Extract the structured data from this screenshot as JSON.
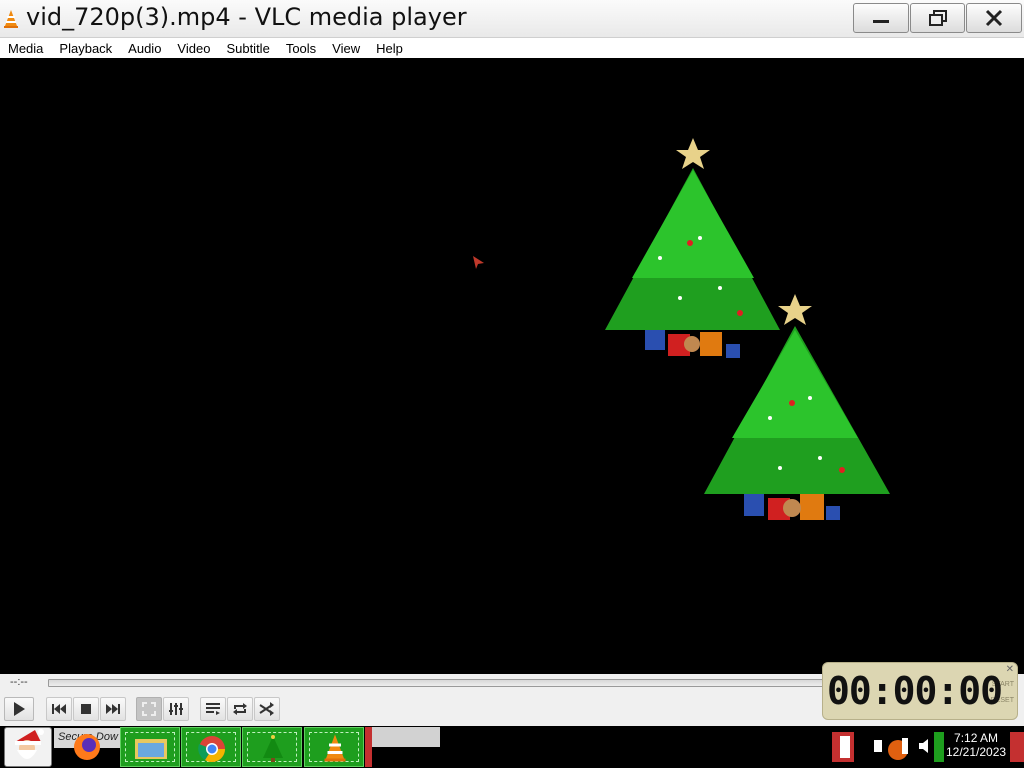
{
  "window": {
    "title": "vid_720p(3).mp4 - VLC media player",
    "icon": "vlc-cone-icon",
    "controls": [
      "minimize-icon",
      "restore-icon",
      "close-icon"
    ]
  },
  "menu": {
    "items": [
      "Media",
      "Playback",
      "Audio",
      "Video",
      "Subtitle",
      "Tools",
      "View",
      "Help"
    ]
  },
  "player": {
    "elapsed": "--:--",
    "progress": 0,
    "buttons": [
      "play-icon",
      "previous-icon",
      "stop-icon",
      "next-icon",
      "fullscreen-icon",
      "extended-settings-icon",
      "playlist-icon",
      "loop-icon",
      "shuffle-icon"
    ]
  },
  "clock_widget": {
    "time": "00:00:00",
    "label_top": "START",
    "label_bottom": "RESET"
  },
  "taskbar": {
    "search_text": "Secure Dow",
    "apps": [
      "santa-start-icon",
      "firefox-icon",
      "file-explorer-icon",
      "chrome-icon",
      "christmas-tree-icon",
      "vlc-cone-icon"
    ],
    "clock": {
      "time": "7:12 AM",
      "date": "12/21/2023"
    }
  },
  "colors": {
    "video_background": "#000000",
    "tree_green": "#22b022",
    "star_gold": "#e8d28a",
    "taskbar_green": "#1e9e1e"
  }
}
